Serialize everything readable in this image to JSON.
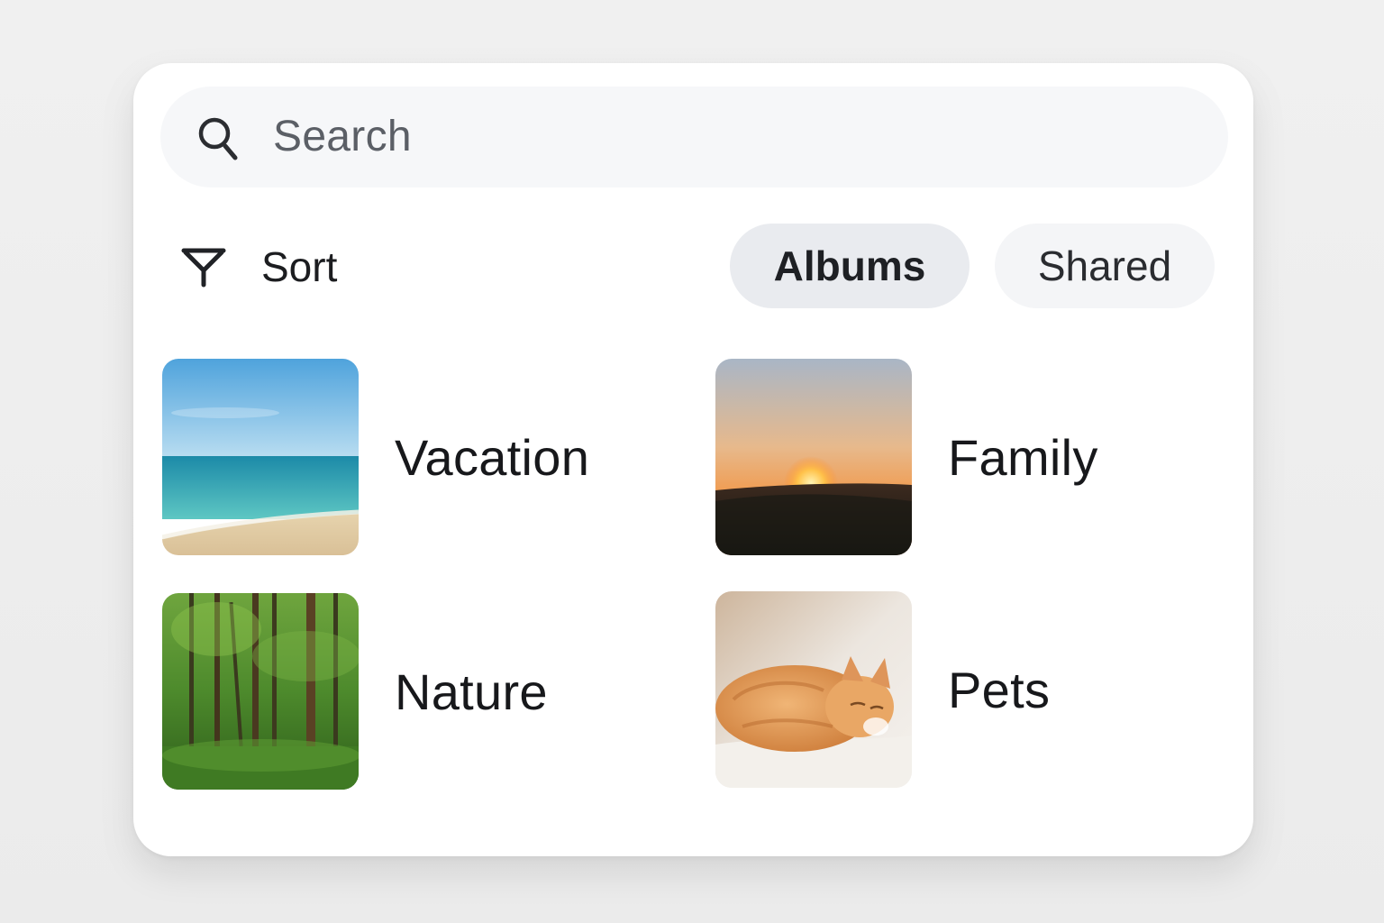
{
  "search": {
    "placeholder": "Search",
    "icon": "search-icon"
  },
  "toolbar": {
    "sort_label": "Sort",
    "sort_icon": "filter-icon"
  },
  "chips": [
    {
      "label": "Albums",
      "selected": true
    },
    {
      "label": "Shared",
      "selected": false
    }
  ],
  "albums": [
    {
      "label": "Vacation",
      "thumbnail": "beach-photo"
    },
    {
      "label": "Family",
      "thumbnail": "sunset-photo"
    },
    {
      "label": "Nature",
      "thumbnail": "forest-photo"
    },
    {
      "label": "Pets",
      "thumbnail": "cat-photo"
    }
  ],
  "colors": {
    "panel_background": "#ffffff",
    "search_background": "#f6f7f9",
    "selected_chip": "#e9ebef",
    "unselected_chip": "#f4f5f7"
  }
}
